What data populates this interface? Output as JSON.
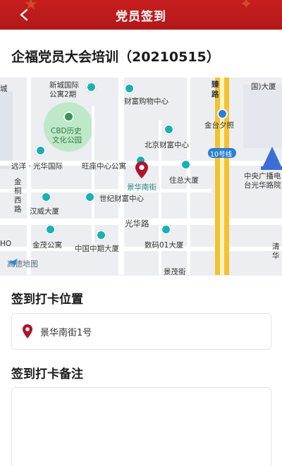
{
  "header": {
    "title": "党员签到"
  },
  "event": {
    "title": "企福党员大会培训（20210515）"
  },
  "map": {
    "provider": "高德地图",
    "labels": {
      "newtown": "新城国际",
      "newtown2": "公寓2期",
      "caifu": "财富购物中心",
      "zhenlu": "臻",
      "zhenlu2": "路",
      "guomao": "国)大厦",
      "cheng": "城",
      "jintaixizhao": "金台夕照",
      "cbd1": "CBD历史",
      "cbd2": "文化公园",
      "beijingcaifu": "北京财富中心",
      "line10": "10号线",
      "yuanyang": "远洋 · 光华国际",
      "wangzuo": "旺座中心公寓",
      "zhuzong": "住总大厦",
      "cctv1": "中央广播电",
      "cctv2": "台光华路院",
      "jin1": "金",
      "jin2": "桐",
      "jin3": "西",
      "jin4": "路",
      "jinghua": "景华南街",
      "century": "世纪财富中心",
      "hanwei": "汉威大厦",
      "guanghua": "光华路",
      "ho": "HO",
      "jinmao": "金茂公寓",
      "zhongguo": "中国中期大厦",
      "shuma": "数码01大厦",
      "qing1": "清",
      "qing2": "华",
      "jingmao": "景茂街"
    }
  },
  "checkin_location": {
    "label": "签到打卡位置",
    "value": "景华南街1号"
  },
  "checkin_note": {
    "label": "签到打卡备注",
    "placeholder": ""
  },
  "colors": {
    "brand_red": "#c81e1e",
    "subway_yellow": "#f2c230",
    "poi_teal": "#19b0b6",
    "pin_red": "#b0142a"
  }
}
